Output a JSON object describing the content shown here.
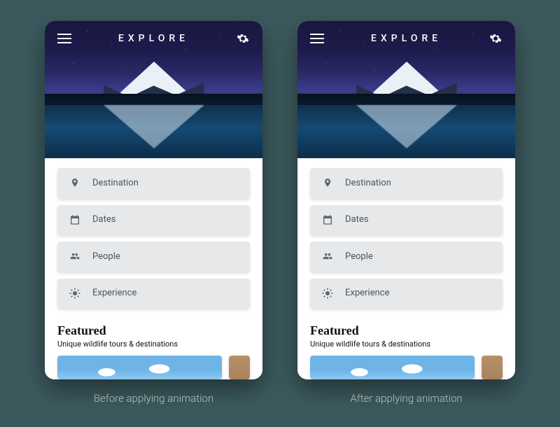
{
  "header": {
    "title": "EXPLORE"
  },
  "filters": [
    {
      "icon": "location-pin-icon",
      "label": "Destination"
    },
    {
      "icon": "calendar-icon",
      "label": "Dates"
    },
    {
      "icon": "people-icon",
      "label": "People"
    },
    {
      "icon": "sun-icon",
      "label": "Experience"
    }
  ],
  "featured": {
    "heading": "Featured",
    "subtitle": "Unique wildlife tours & destinations"
  },
  "captions": {
    "left": "Before applying animation",
    "right": "After applying animation"
  }
}
